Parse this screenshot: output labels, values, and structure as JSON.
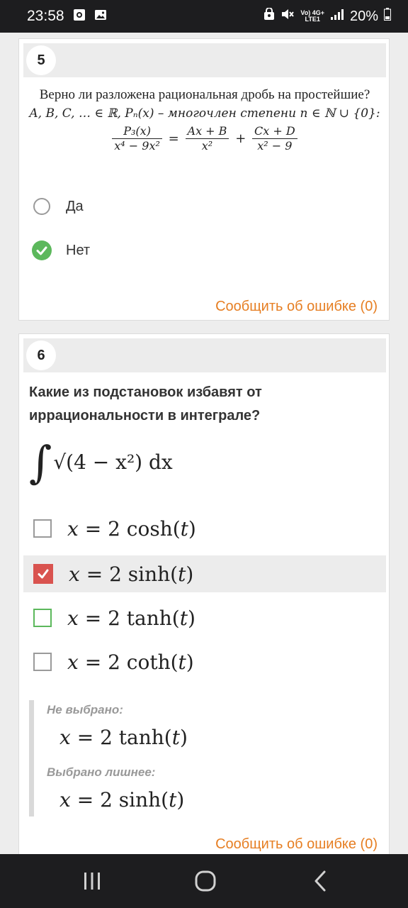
{
  "status_bar": {
    "time": "23:58",
    "network_top": "Vo) 4G+",
    "network_bottom": "LTE1",
    "battery": "20%",
    "icons": [
      "camera-icon",
      "image-icon",
      "lock-icon",
      "mute-icon",
      "signal-icon",
      "battery-icon"
    ]
  },
  "q5": {
    "number": "5",
    "question": "Верно ли разложена рациональная дробь на простейшие?",
    "math_line": "A, B, C, … ∈ ℝ,  Pₙ(x) – многочлен степени n ∈ ℕ ∪ {0}:",
    "fraction_lhs_num": "P₃(x)",
    "fraction_lhs_den": "x⁴ − 9x²",
    "fraction_rhs1_num": "Ax + B",
    "fraction_rhs1_den": "x²",
    "fraction_rhs2_num": "Cx + D",
    "fraction_rhs2_den": "x² − 9",
    "options": [
      {
        "label": "Да",
        "checked": false
      },
      {
        "label": "Нет",
        "checked": true
      }
    ],
    "report": "Сообщить об ошибке (0)"
  },
  "q6": {
    "number": "6",
    "question": "Какие из подстановок избавят от иррациональности в интеграле?",
    "integral": "√(4 − x²) dx",
    "options": [
      {
        "var": "x",
        "rhs": "= 2 cosh(",
        "arg": "t",
        "close": ")",
        "state": "unchecked"
      },
      {
        "var": "x",
        "rhs": "= 2 sinh(",
        "arg": "t",
        "close": ")",
        "state": "checked-wrong"
      },
      {
        "var": "x",
        "rhs": "= 2 tanh(",
        "arg": "t",
        "close": ")",
        "state": "missed-correct"
      },
      {
        "var": "x",
        "rhs": "= 2 coth(",
        "arg": "t",
        "close": ")",
        "state": "unchecked"
      }
    ],
    "feedback": {
      "not_selected_label": "Не выбрано:",
      "not_selected_value": "= 2 tanh(",
      "extra_label": "Выбрано лишнее:",
      "extra_value": "= 2 sinh("
    },
    "report": "Сообщить об ошибке (0)"
  },
  "colors": {
    "accent_orange": "#e67e22",
    "correct_green": "#5cb85c",
    "wrong_red": "#d9534f"
  }
}
